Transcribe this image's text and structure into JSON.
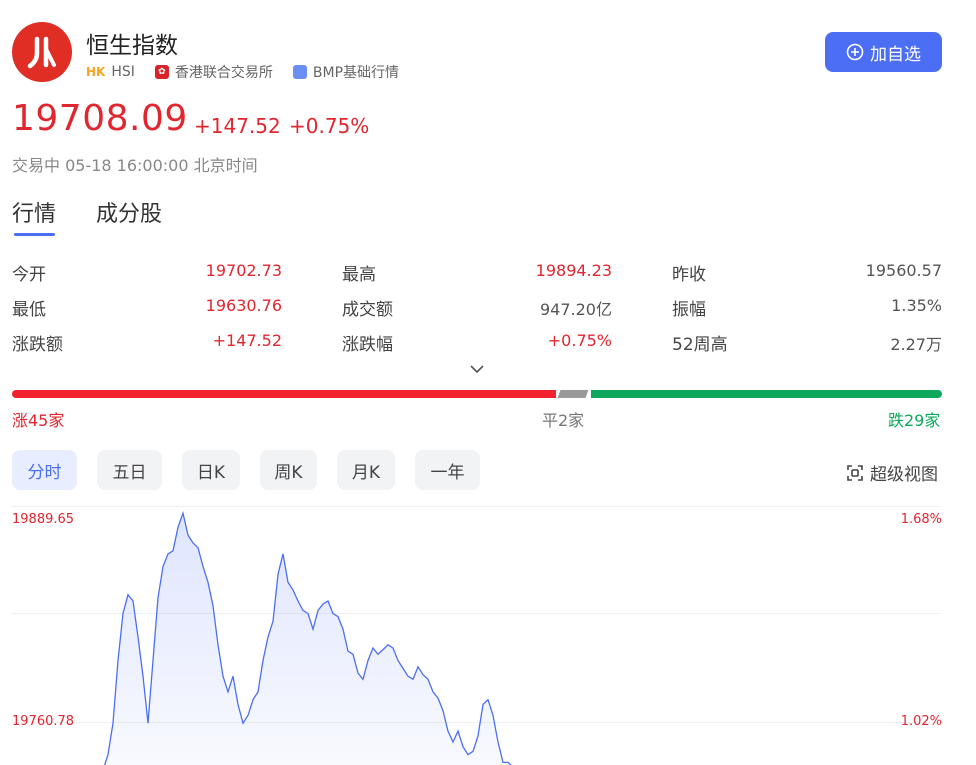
{
  "header": {
    "title": "恒生指数",
    "market_tag": "HK",
    "code": "HSI",
    "exchange": "香港联合交易所",
    "source": "BMP基础行情",
    "add_button": "加自选"
  },
  "quote": {
    "price": "19708.09",
    "change": "+147.52",
    "change_pct": "+0.75%",
    "status": "交易中 05-18 16:00:00 北京时间"
  },
  "tabs": [
    "行情",
    "成分股"
  ],
  "stats": [
    {
      "label": "今开",
      "value": "19702.73",
      "color": "red"
    },
    {
      "label": "最高",
      "value": "19894.23",
      "color": "red"
    },
    {
      "label": "昨收",
      "value": "19560.57",
      "color": "grey"
    },
    {
      "label": "最低",
      "value": "19630.76",
      "color": "red"
    },
    {
      "label": "成交额",
      "value": "947.20亿",
      "color": "grey"
    },
    {
      "label": "振幅",
      "value": "1.35%",
      "color": "grey"
    },
    {
      "label": "涨跌额",
      "value": "+147.52",
      "color": "red"
    },
    {
      "label": "涨跌幅",
      "value": "+0.75%",
      "color": "red"
    },
    {
      "label": "52周高",
      "value": "2.27万",
      "color": "grey"
    }
  ],
  "breadth": {
    "up": "涨45家",
    "flat": "平2家",
    "down": "跌29家"
  },
  "period_tabs": [
    "分时",
    "五日",
    "日K",
    "周K",
    "月K",
    "一年"
  ],
  "super_view": "超级视图",
  "colors": {
    "accent": "#4b6ef5",
    "up": "#e0262f",
    "down": "#0fa75b"
  },
  "chart_data": {
    "type": "area",
    "y_ticks_left": [
      "19889.65",
      "19760.78"
    ],
    "y_ticks_right": [
      "1.68%",
      "1.02%"
    ],
    "values": [
      19715,
      19722,
      19718,
      19730,
      19740,
      19760,
      19800,
      19830,
      19842,
      19838,
      19815,
      19790,
      19760,
      19800,
      19840,
      19860,
      19868,
      19870,
      19885,
      19894,
      19880,
      19875,
      19872,
      19860,
      19850,
      19835,
      19810,
      19790,
      19780,
      19790,
      19772,
      19760,
      19765,
      19775,
      19780,
      19800,
      19815,
      19825,
      19855,
      19868,
      19850,
      19845,
      19838,
      19832,
      19830,
      19820,
      19832,
      19836,
      19838,
      19830,
      19828,
      19820,
      19806,
      19804,
      19792,
      19788,
      19800,
      19808,
      19804,
      19807,
      19810,
      19808,
      19800,
      19795,
      19790,
      19788,
      19796,
      19791,
      19788,
      19780,
      19776,
      19768,
      19755,
      19748,
      19755,
      19745,
      19740,
      19742,
      19752,
      19772,
      19775,
      19765,
      19748,
      19735,
      19735,
      19732
    ]
  }
}
